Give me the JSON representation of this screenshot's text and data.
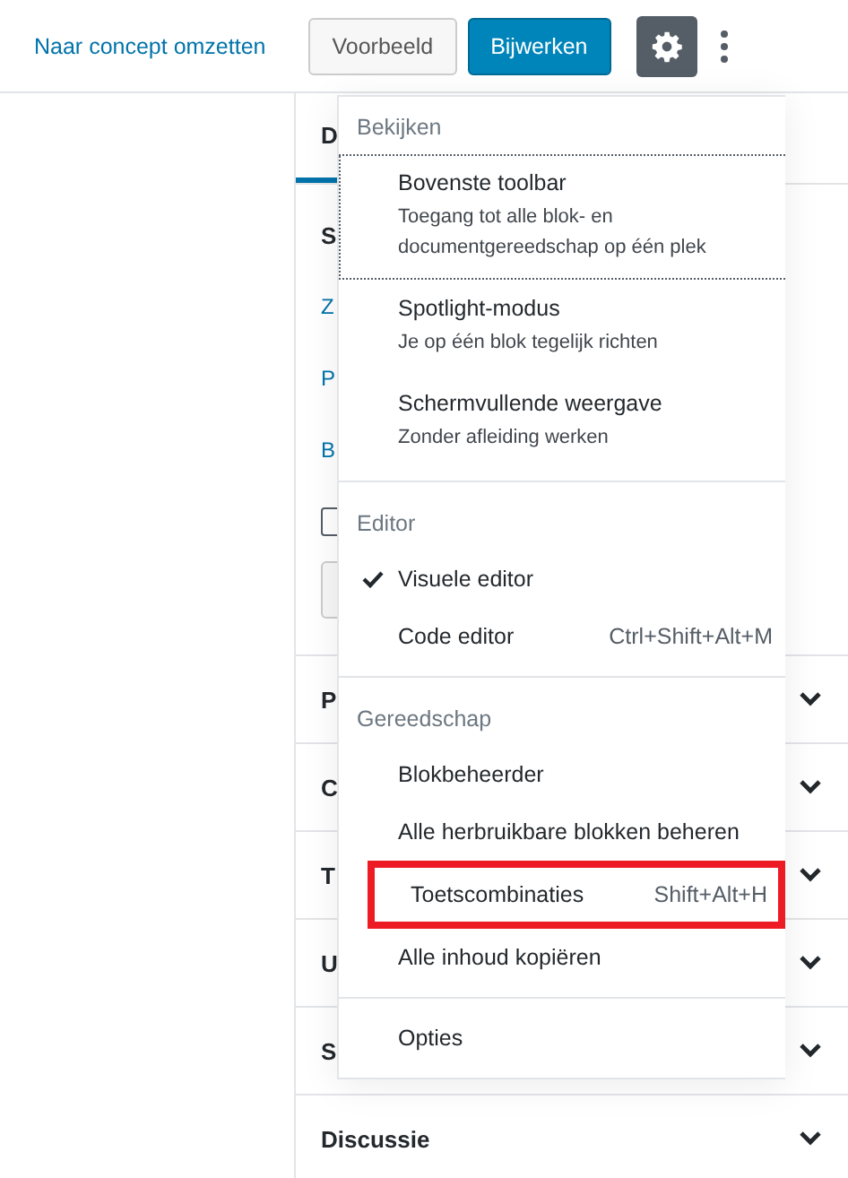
{
  "header": {
    "draft_link": "Naar concept omzetten",
    "preview_button": "Voorbeeld",
    "update_button": "Bijwerken",
    "settings_active": true
  },
  "sidebar": {
    "tabs": [
      {
        "label": "D",
        "selected": true
      }
    ],
    "items": [
      {
        "kind": "text",
        "label": "S"
      },
      {
        "kind": "link",
        "label": "Z"
      },
      {
        "kind": "link",
        "label": "P"
      },
      {
        "kind": "link",
        "label": "B"
      },
      {
        "kind": "checkbox",
        "checked": false
      },
      {
        "kind": "button"
      }
    ],
    "panels": [
      {
        "label": "P"
      },
      {
        "label": "C"
      },
      {
        "label": "T"
      },
      {
        "label": "U"
      },
      {
        "label": "S"
      },
      {
        "label": "Discussie"
      }
    ]
  },
  "menu": {
    "groups": [
      {
        "title": "Bekijken",
        "items": [
          {
            "label": "Bovenste toolbar",
            "description": "Toegang tot alle blok- en documentgereedschap op één plek",
            "focused": true,
            "checked": false,
            "highlighted": false
          },
          {
            "label": "Spotlight-modus",
            "description": "Je op één blok tegelijk richten",
            "focused": false,
            "checked": false,
            "highlighted": false
          },
          {
            "label": "Schermvullende weergave",
            "description": "Zonder afleiding werken",
            "focused": false,
            "checked": false,
            "highlighted": false
          }
        ]
      },
      {
        "title": "Editor",
        "items": [
          {
            "label": "Visuele editor",
            "focused": false,
            "checked": true,
            "highlighted": false
          },
          {
            "label": "Code editor",
            "shortcut": "Ctrl+Shift+Alt+M",
            "focused": false,
            "checked": false,
            "highlighted": false
          }
        ]
      },
      {
        "title": "Gereedschap",
        "items": [
          {
            "label": "Blokbeheerder",
            "focused": false,
            "checked": false,
            "highlighted": false
          },
          {
            "label": "Alle herbruikbare blokken beheren",
            "focused": false,
            "checked": false,
            "highlighted": false
          },
          {
            "label": "Toetscombinaties",
            "shortcut": "Shift+Alt+H",
            "focused": false,
            "checked": false,
            "highlighted": true
          },
          {
            "label": "Alle inhoud kopiëren",
            "focused": false,
            "checked": false,
            "highlighted": false
          }
        ]
      },
      {
        "items": [
          {
            "label": "Opties",
            "focused": false,
            "checked": false,
            "highlighted": false
          }
        ]
      }
    ]
  }
}
